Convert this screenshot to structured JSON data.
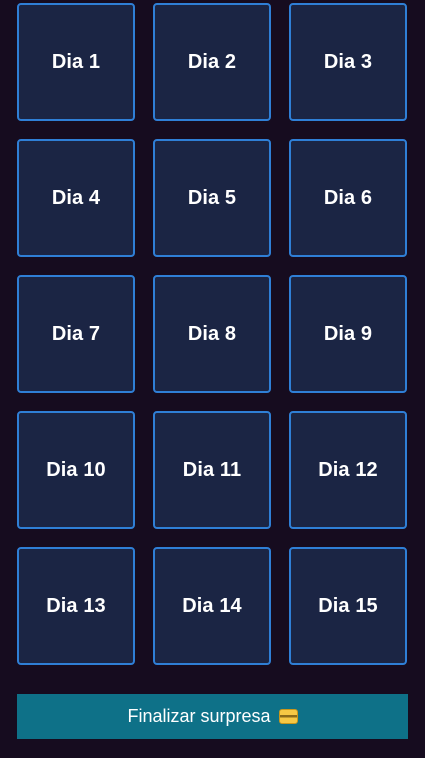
{
  "days": [
    {
      "label": "Dia 1"
    },
    {
      "label": "Dia 2"
    },
    {
      "label": "Dia 3"
    },
    {
      "label": "Dia 4"
    },
    {
      "label": "Dia 5"
    },
    {
      "label": "Dia 6"
    },
    {
      "label": "Dia 7"
    },
    {
      "label": "Dia 8"
    },
    {
      "label": "Dia 9"
    },
    {
      "label": "Dia 10"
    },
    {
      "label": "Dia 11"
    },
    {
      "label": "Dia 12"
    },
    {
      "label": "Dia 13"
    },
    {
      "label": "Dia 14"
    },
    {
      "label": "Dia 15"
    }
  ],
  "finish_button": {
    "label": "Finalizar surpresa",
    "icon": "credit-card-icon"
  },
  "colors": {
    "background": "#160c1f",
    "card_fill": "#1b2544",
    "card_border": "#2f7fd6",
    "button": "#0e7188"
  }
}
